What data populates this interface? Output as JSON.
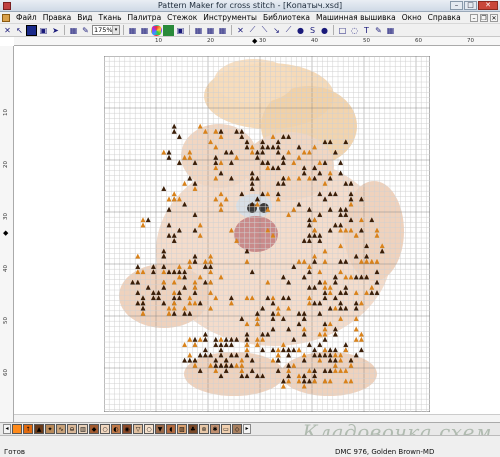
{
  "window": {
    "title": "Pattern Maker for cross stitch - [Копатыч.xsd]",
    "buttons": {
      "minimize": "–",
      "maximize": "□",
      "close": "✕"
    }
  },
  "menu": {
    "items": [
      "Файл",
      "Правка",
      "Вид",
      "Ткань",
      "Палитра",
      "Стежок",
      "Инструменты",
      "Библиотека",
      "Машинная вышивка",
      "Окно",
      "Справка"
    ],
    "mdi": {
      "minimize": "–",
      "restore": "❐",
      "close": "✕"
    }
  },
  "toolbar": {
    "zoom_value": "175%",
    "zoom_arrow": "▾",
    "glyphs": {
      "close_x": "✕",
      "select_arrow": "↖",
      "fill_bucket": "▣",
      "grid": "▦",
      "full_cross": "✕",
      "half_stitch": "⟋",
      "quarter_stitch": "⟍",
      "backstitch": "↘",
      "bead": "●",
      "text_tool": "T",
      "specialty_s": "S",
      "rect_select": "□",
      "lasso": "◌",
      "eyedropper": "✎",
      "pointer": "➤"
    }
  },
  "rulers": {
    "top_labels": [
      "10",
      "20",
      "30",
      "40",
      "50",
      "60",
      "70"
    ],
    "left_labels": [
      "10",
      "20",
      "30",
      "40",
      "50",
      "60"
    ],
    "top_marker": "◆",
    "left_marker": "◆"
  },
  "palette": {
    "nav_left": "◂",
    "nav_right": "▸",
    "swatches": [
      {
        "color": "#ff8a1a",
        "symbol": ""
      },
      {
        "color": "#e06a10",
        "symbol": "↑"
      },
      {
        "color": "#6a3b1a",
        "symbol": "▲"
      },
      {
        "color": "#b88a5a",
        "symbol": "✦"
      },
      {
        "color": "#c8a27a",
        "symbol": "∿"
      },
      {
        "color": "#d9b899",
        "symbol": "⊖"
      },
      {
        "color": "#e8d0b8",
        "symbol": "▥"
      },
      {
        "color": "#a05a30",
        "symbol": "◆"
      },
      {
        "color": "#f2d8c0",
        "symbol": "○"
      },
      {
        "color": "#c07a4a",
        "symbol": "◐"
      },
      {
        "color": "#8a4a2a",
        "symbol": "◉"
      },
      {
        "color": "#e0c0a0",
        "symbol": "▽"
      },
      {
        "color": "#f4e0cc",
        "symbol": "○"
      },
      {
        "color": "#9a6a4a",
        "symbol": "▼"
      },
      {
        "color": "#b06a40",
        "symbol": "◖"
      },
      {
        "color": "#d8a070",
        "symbol": "▨"
      },
      {
        "color": "#7a4a2a",
        "symbol": "♣"
      },
      {
        "color": "#e8c8a8",
        "symbol": "⊚"
      },
      {
        "color": "#c09070",
        "symbol": "✱"
      },
      {
        "color": "#f0d0b0",
        "symbol": "▭"
      },
      {
        "color": "#a88060",
        "symbol": "◇"
      }
    ]
  },
  "status": {
    "left": "Готов",
    "right": "DMC 976, Golden Brown-MD"
  },
  "watermark": "Кладовочка.схем",
  "colors": {
    "hat": "#f5d6b0",
    "fur": "#f4dccb",
    "fur_shadow": "#e7c6b3",
    "spot_dark": "#3a1e08",
    "spot_orange": "#d9821a",
    "nose": "#c98a8a",
    "eye": "#d8dfe6",
    "grid_minor": "#d0d0d0",
    "grid_major": "#8a8a8a"
  }
}
